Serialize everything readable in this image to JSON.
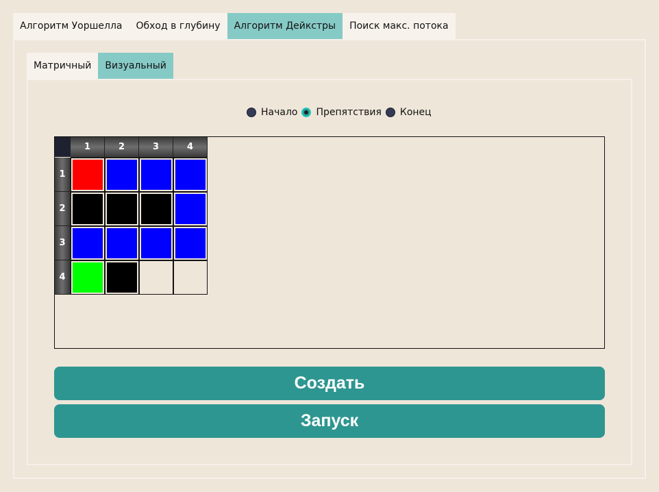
{
  "tabs": [
    {
      "label": "Алгоритм Уоршелла",
      "active": false
    },
    {
      "label": "Обход в глубину",
      "active": false
    },
    {
      "label": "Алгоритм Дейкстры",
      "active": true
    },
    {
      "label": "Поиск макс. потока",
      "active": false
    }
  ],
  "subtabs": [
    {
      "label": "Матричный",
      "active": false
    },
    {
      "label": "Визуальный",
      "active": true
    }
  ],
  "radios": [
    {
      "label": "Начало",
      "checked": false
    },
    {
      "label": "Препятствия",
      "checked": true
    },
    {
      "label": "Конец",
      "checked": false
    }
  ],
  "grid": {
    "columns": [
      "1",
      "2",
      "3",
      "4"
    ],
    "rows": [
      "1",
      "2",
      "3",
      "4"
    ],
    "cells": [
      [
        "red",
        "blue",
        "blue",
        "blue"
      ],
      [
        "black",
        "black",
        "black",
        "blue"
      ],
      [
        "blue",
        "blue",
        "blue",
        "blue"
      ],
      [
        "green",
        "black",
        "empty",
        "empty"
      ]
    ]
  },
  "colors": {
    "red": "#ff0000",
    "blue": "#0000ff",
    "black": "#000000",
    "green": "#00ff00",
    "accent": "#2e9690",
    "tab_active": "#86cac6"
  },
  "buttons": {
    "create_label": "Создать",
    "run_label": "Запуск"
  }
}
